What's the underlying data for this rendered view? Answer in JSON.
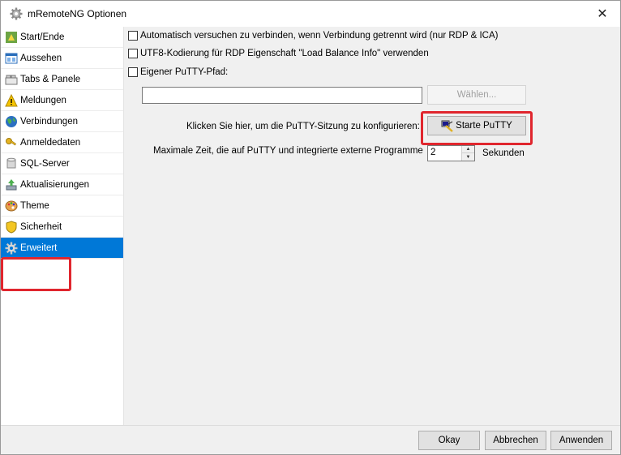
{
  "window": {
    "title": "mRemoteNG Optionen",
    "close_glyph": "✕"
  },
  "sidebar": {
    "items": [
      {
        "label": "Start/Ende",
        "icon": "start-end-icon"
      },
      {
        "label": "Aussehen",
        "icon": "appearance-icon"
      },
      {
        "label": "Tabs & Panele",
        "icon": "tabs-icon"
      },
      {
        "label": "Meldungen",
        "icon": "warning-icon"
      },
      {
        "label": "Verbindungen",
        "icon": "globe-icon"
      },
      {
        "label": "Anmeldedaten",
        "icon": "key-icon"
      },
      {
        "label": "SQL-Server",
        "icon": "database-icon"
      },
      {
        "label": "Aktualisierungen",
        "icon": "update-icon"
      },
      {
        "label": "Theme",
        "icon": "palette-icon"
      },
      {
        "label": "Sicherheit",
        "icon": "shield-icon"
      },
      {
        "label": "Erweitert",
        "icon": "gear-icon",
        "selected": true
      }
    ]
  },
  "content": {
    "auto_reconnect_label": "Automatisch versuchen zu verbinden, wenn Verbindung getrennt wird (nur RDP & ICA)",
    "utf8_label": "UTF8-Kodierung für RDP Eigenschaft \"Load Balance Info\" verwenden",
    "custom_putty_label": "Eigener PuTTY-Pfad:",
    "putty_path_value": "",
    "browse_button_label": "Wählen...",
    "configure_putty_label": "Klicken Sie hier, um die PuTTY-Sitzung zu konfigurieren:",
    "start_putty_button_label": "Starte PuTTY",
    "max_time_label": "Maximale Zeit, die auf PuTTY und integrierte externe Programme",
    "max_time_value": "2",
    "seconds_label": "Sekunden"
  },
  "footer": {
    "ok_label": "Okay",
    "cancel_label": "Abbrechen",
    "apply_label": "Anwenden"
  },
  "colors": {
    "selection": "#0078d7",
    "highlight_box": "#e0262e"
  }
}
